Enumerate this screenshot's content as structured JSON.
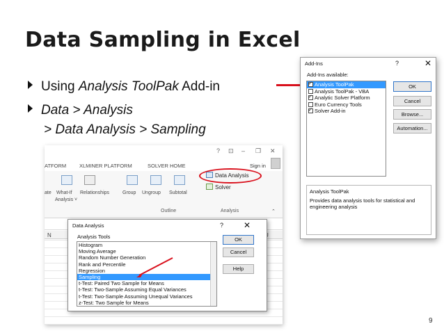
{
  "slide": {
    "title": "Data Sampling in Excel",
    "bullet1": {
      "pre": "Using ",
      "italic": "Analysis ToolPak",
      "post": " Add-in"
    },
    "bullet2": {
      "line1": "Data > Analysis",
      "line2": "> Data Analysis > Sampling"
    },
    "page_number": "9"
  },
  "addins_dialog": {
    "title": "Add-Ins",
    "help": "?",
    "close": "✕",
    "available_label": "Add-Ins available:",
    "items": [
      {
        "label": "Analysis ToolPak",
        "checked": true,
        "selected": true
      },
      {
        "label": "Analysis ToolPak - VBA",
        "checked": false,
        "selected": false
      },
      {
        "label": "Analytic Solver Platform",
        "checked": true,
        "selected": false
      },
      {
        "label": "Euro Currency Tools",
        "checked": false,
        "selected": false
      },
      {
        "label": "Solver Add-in",
        "checked": true,
        "selected": false
      }
    ],
    "buttons": {
      "ok": "OK",
      "cancel": "Cancel",
      "browse": "Browse...",
      "automation": "Automation..."
    },
    "desc_title": "Analysis ToolPak",
    "desc_text": "Provides data analysis tools for statistical and engineering analysis"
  },
  "excel": {
    "window_controls": {
      "help": "?",
      "ribbon": "⊡",
      "minimize": "–",
      "restore": "❐",
      "close": "✕"
    },
    "tabs": {
      "platform": "ATFORM",
      "xlminer": "XLMINER PLATFORM",
      "solver_home": "SOLVER HOME"
    },
    "signin": "Sign in",
    "ribbon": {
      "ate": "ate",
      "whatif": "What-If",
      "analysis": "Analysis ˅",
      "relationships": "Relationships",
      "group": "Group",
      "ungroup": "Ungroup",
      "subtotal": "Subtotal",
      "outline_label": "Outline",
      "analysis_label": "Analysis",
      "data_analysis": "Data Analysis",
      "solver": "Solver",
      "expand": "⌃"
    },
    "columns": {
      "left": "N",
      "right": "U"
    }
  },
  "data_analysis_dialog": {
    "title": "Data Analysis",
    "help": "?",
    "close": "✕",
    "tools_label": "Analysis Tools",
    "items": [
      "Histogram",
      "Moving Average",
      "Random Number Generation",
      "Rank and Percentile",
      "Regression",
      "Sampling",
      "t-Test: Paired Two Sample for Means",
      "t-Test: Two-Sample Assuming Equal Variances",
      "t-Test: Two-Sample Assuming Unequal Variances",
      "z-Test: Two Sample for Means"
    ],
    "selected_index": 5,
    "buttons": {
      "ok": "OK",
      "cancel": "Cancel",
      "help": "Help"
    }
  },
  "colors": {
    "annotation_red": "#d9101c",
    "selection_blue": "#3399ff"
  }
}
